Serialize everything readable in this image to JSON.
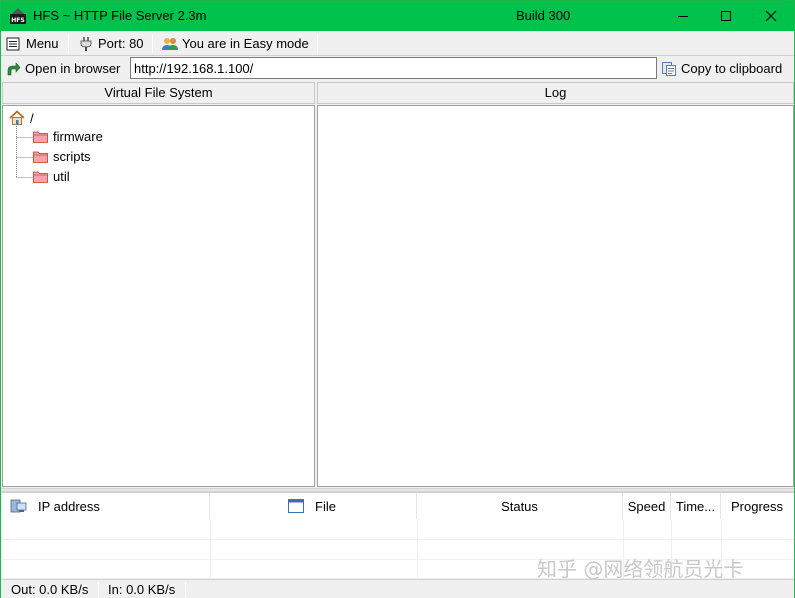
{
  "window": {
    "title": "HFS ~ HTTP File Server 2.3m",
    "build": "Build 300",
    "accent_color": "#00c14b"
  },
  "toolbar": {
    "menu_label": "Menu",
    "port_label": "Port: 80",
    "mode_label": "You are in Easy mode",
    "open_browser_label": "Open in browser",
    "url_value": "http://192.168.1.100/",
    "copy_label": "Copy to clipboard"
  },
  "vfs": {
    "header": "Virtual File System",
    "root_label": "/",
    "items": [
      {
        "label": "firmware",
        "icon": "folder-icon"
      },
      {
        "label": "scripts",
        "icon": "folder-icon"
      },
      {
        "label": "util",
        "icon": "folder-icon"
      }
    ]
  },
  "log": {
    "header": "Log"
  },
  "connections": {
    "columns": [
      "IP address",
      "File",
      "Status",
      "Speed",
      "Time...",
      "Progress"
    ]
  },
  "status": {
    "out": "Out: 0.0 KB/s",
    "in": "In: 0.0 KB/s"
  },
  "watermark": "知乎 @网络领航员光卡"
}
